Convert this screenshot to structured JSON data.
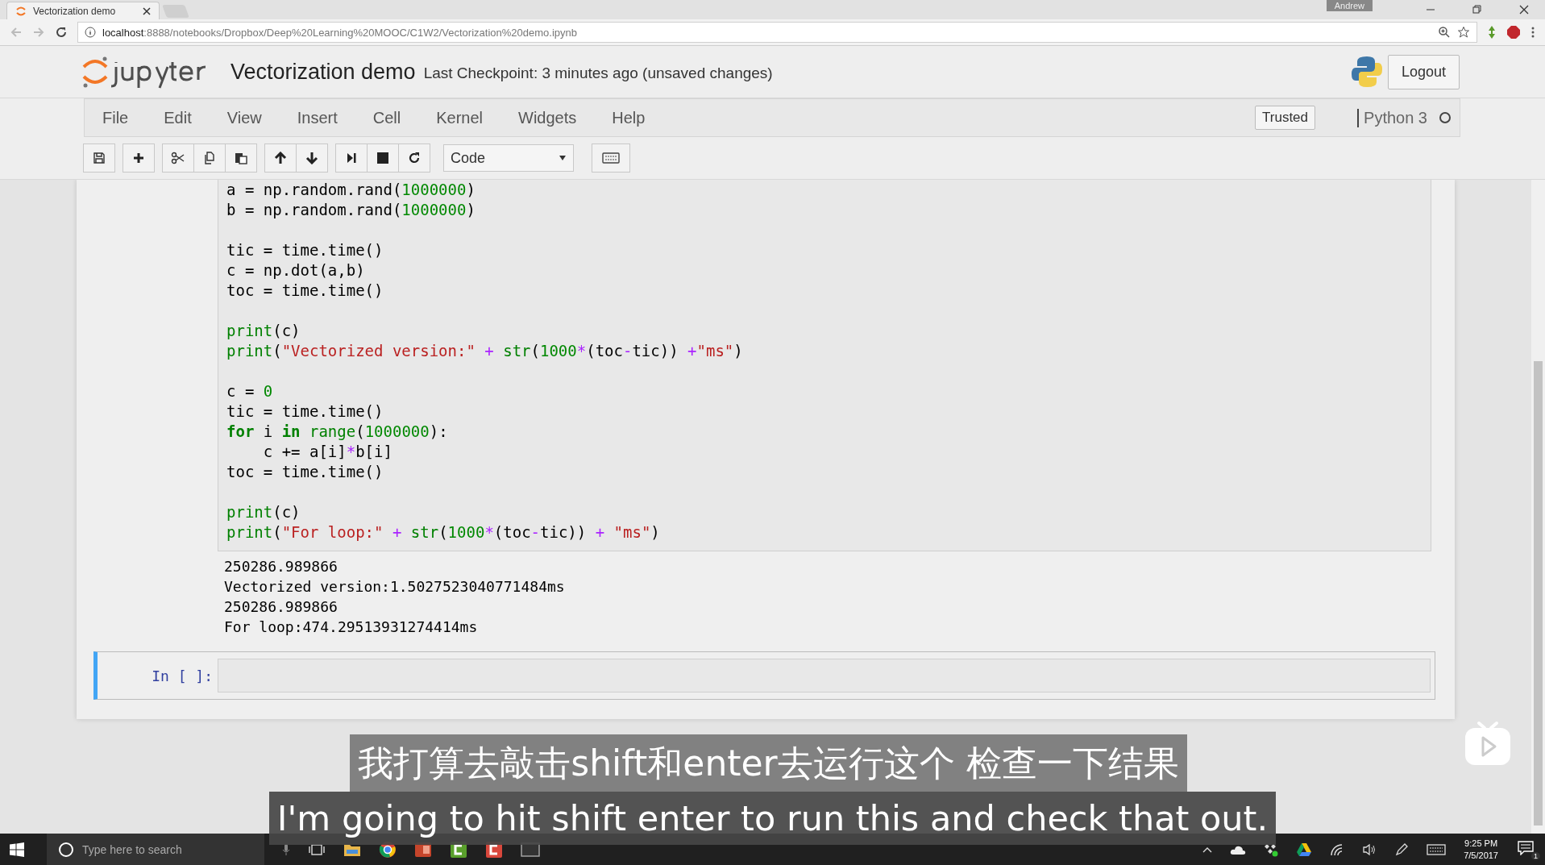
{
  "browser": {
    "tab_title": "Vectorization demo",
    "url_host": "localhost",
    "url_rest": ":8888/notebooks/Dropbox/Deep%20Learning%20MOOC/C1W2/Vectorization%20demo.ipynb",
    "user_badge": "Andrew"
  },
  "header": {
    "notebook_name": "Vectorization demo",
    "checkpoint": "Last Checkpoint: 3 minutes ago (unsaved changes)",
    "logout": "Logout"
  },
  "menu": [
    "File",
    "Edit",
    "View",
    "Insert",
    "Cell",
    "Kernel",
    "Widgets",
    "Help"
  ],
  "trusted": "Trusted",
  "kernel": "Python 3",
  "cell_type": "Code",
  "cells": [
    {
      "selected": false,
      "code_blocks": [
        [
          [
            {
              "kind": "plain",
              "text": "a = np.random.rand("
            },
            {
              "kind": "number",
              "text": "1000000"
            },
            {
              "kind": "plain",
              "text": ")"
            }
          ],
          [
            {
              "kind": "plain",
              "text": "b = np.random.rand("
            },
            {
              "kind": "number",
              "text": "1000000"
            },
            {
              "kind": "plain",
              "text": ")"
            }
          ]
        ],
        [
          [
            {
              "kind": "plain",
              "text": "tic = time.time()"
            }
          ],
          [
            {
              "kind": "plain",
              "text": "c = np.dot(a,b)"
            }
          ],
          [
            {
              "kind": "plain",
              "text": "toc = time.time()"
            }
          ]
        ],
        [
          [
            {
              "kind": "builtin",
              "text": "print"
            },
            {
              "kind": "plain",
              "text": "(c)"
            }
          ],
          [
            {
              "kind": "builtin",
              "text": "print"
            },
            {
              "kind": "plain",
              "text": "("
            },
            {
              "kind": "string",
              "text": "\"Vectorized version:\""
            },
            {
              "kind": "operator",
              "text": " + "
            },
            {
              "kind": "builtin",
              "text": "str"
            },
            {
              "kind": "plain",
              "text": "("
            },
            {
              "kind": "number",
              "text": "1000"
            },
            {
              "kind": "operator",
              "text": "*"
            },
            {
              "kind": "plain",
              "text": "(toc"
            },
            {
              "kind": "operator",
              "text": "-"
            },
            {
              "kind": "plain",
              "text": "tic)) "
            },
            {
              "kind": "operator",
              "text": "+"
            },
            {
              "kind": "string",
              "text": "\"ms\""
            },
            {
              "kind": "plain",
              "text": ")"
            }
          ]
        ],
        [
          [
            {
              "kind": "plain",
              "text": "c = "
            },
            {
              "kind": "number",
              "text": "0"
            }
          ],
          [
            {
              "kind": "plain",
              "text": "tic = time.time()"
            }
          ],
          [
            {
              "kind": "keyword",
              "text": "for"
            },
            {
              "kind": "plain",
              "text": " i "
            },
            {
              "kind": "keyword",
              "text": "in "
            },
            {
              "kind": "builtin",
              "text": "range"
            },
            {
              "kind": "plain",
              "text": "("
            },
            {
              "kind": "number",
              "text": "1000000"
            },
            {
              "kind": "plain",
              "text": "):"
            }
          ],
          [
            {
              "kind": "plain",
              "text": "    c += a[i]"
            },
            {
              "kind": "operator",
              "text": "*"
            },
            {
              "kind": "plain",
              "text": "b[i]"
            }
          ],
          [
            {
              "kind": "plain",
              "text": "toc = time.time()"
            }
          ]
        ],
        [
          [
            {
              "kind": "builtin",
              "text": "print"
            },
            {
              "kind": "plain",
              "text": "(c)"
            }
          ],
          [
            {
              "kind": "builtin",
              "text": "print"
            },
            {
              "kind": "plain",
              "text": "("
            },
            {
              "kind": "string",
              "text": "\"For loop:\""
            },
            {
              "kind": "operator",
              "text": " + "
            },
            {
              "kind": "builtin",
              "text": "str"
            },
            {
              "kind": "plain",
              "text": "("
            },
            {
              "kind": "number",
              "text": "1000"
            },
            {
              "kind": "operator",
              "text": "*"
            },
            {
              "kind": "plain",
              "text": "(toc"
            },
            {
              "kind": "operator",
              "text": "-"
            },
            {
              "kind": "plain",
              "text": "tic)) "
            },
            {
              "kind": "operator",
              "text": "+ "
            },
            {
              "kind": "string",
              "text": "\"ms\""
            },
            {
              "kind": "plain",
              "text": ")"
            }
          ]
        ]
      ],
      "output": [
        "250286.989866",
        "Vectorized version:1.5027523040771484ms",
        "250286.989866",
        "For loop:474.29513931274414ms"
      ]
    },
    {
      "selected": true,
      "prompt": "In [ ]:"
    }
  ],
  "subtitles": {
    "chinese": "我打算去敲击shift和enter去运行这个 检查一下结果",
    "english": "I'm going to hit shift enter to run this and check that out."
  },
  "taskbar": {
    "search_placeholder": "Type here to search",
    "time": "9:25 PM",
    "date": "7/5/2017",
    "notification_count": "1"
  }
}
